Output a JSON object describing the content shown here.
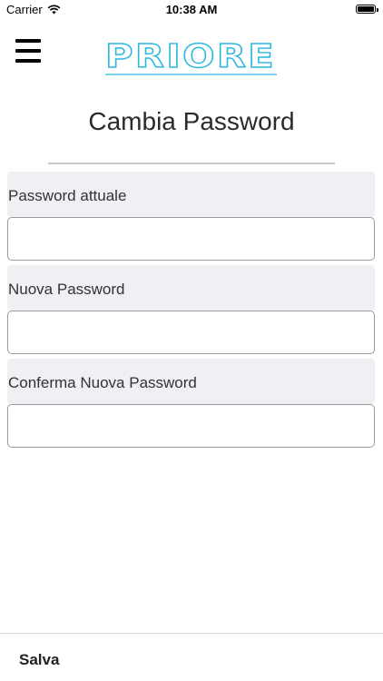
{
  "status_bar": {
    "carrier": "Carrier",
    "time": "10:38 AM",
    "battery_level": 1.0
  },
  "header": {
    "logo_text": "PRIORE",
    "logo_color": "#2bb7e0"
  },
  "page": {
    "title": "Cambia Password"
  },
  "form": {
    "fields": [
      {
        "label": "Password attuale",
        "value": ""
      },
      {
        "label": "Nuova Password",
        "value": ""
      },
      {
        "label": "Conferma Nuova Password",
        "value": ""
      }
    ]
  },
  "footer": {
    "save_label": "Salva"
  }
}
